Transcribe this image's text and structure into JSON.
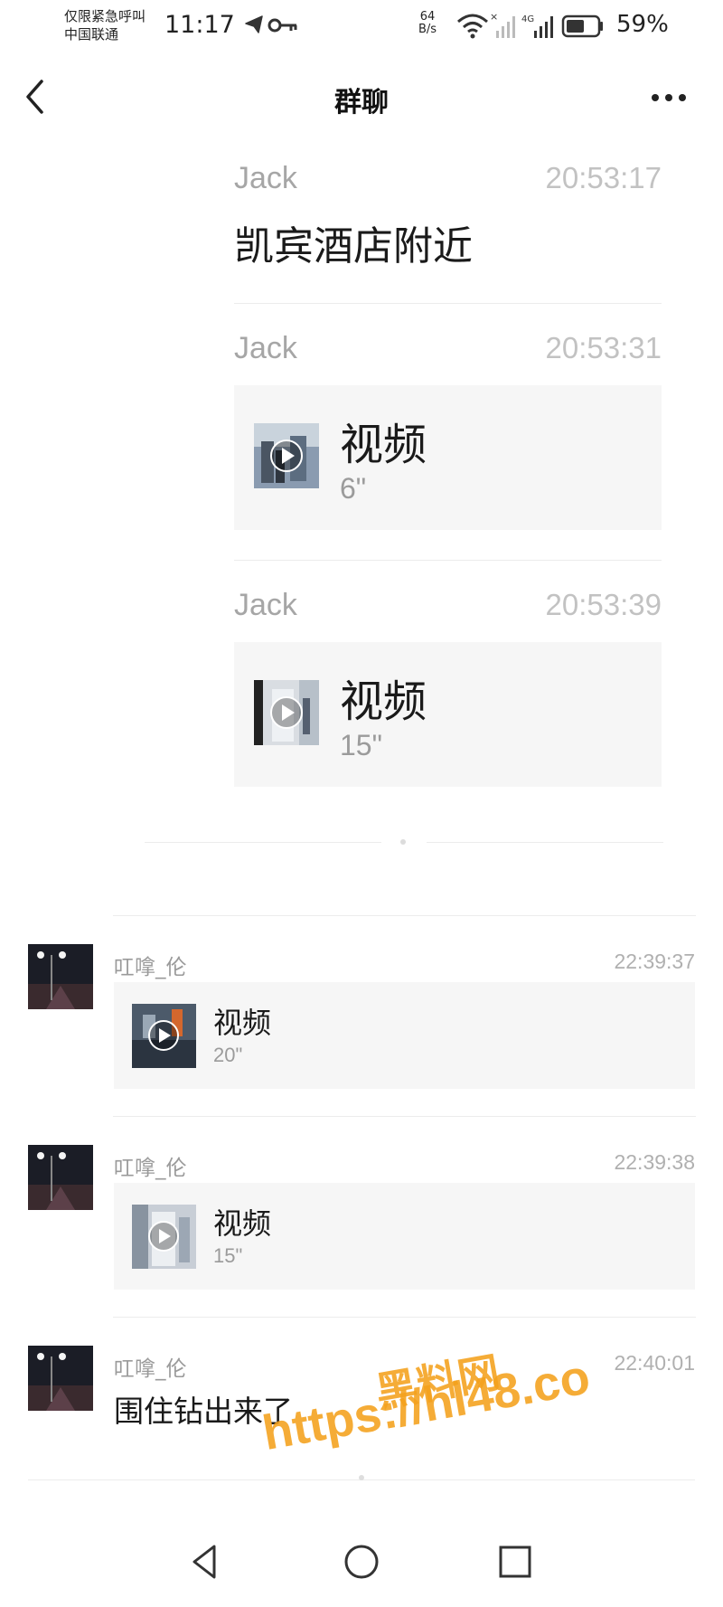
{
  "status_bar": {
    "carrier_line1": "仅限紧急呼叫",
    "carrier_line2": "中国联通",
    "time": "11:17",
    "net_speed_value": "64",
    "net_speed_unit": "B/s",
    "network_type": "4G",
    "battery_percent": "59%",
    "icons": [
      "telegram-icon",
      "key-icon",
      "wifi-icon",
      "signal-icon",
      "battery-icon"
    ]
  },
  "header": {
    "title": "群聊",
    "icons": [
      "back-chevron-icon",
      "more-dots-icon"
    ]
  },
  "quoted": [
    {
      "sender": "Jack",
      "time": "20:53:17",
      "type": "text",
      "text": "凯宾酒店附近"
    },
    {
      "sender": "Jack",
      "time": "20:53:31",
      "type": "video",
      "label": "视频",
      "duration": "6\""
    },
    {
      "sender": "Jack",
      "time": "20:53:39",
      "type": "video",
      "label": "视频",
      "duration": "15\""
    }
  ],
  "messages": [
    {
      "sender": "叿嗱_伦",
      "time": "22:39:37",
      "type": "video",
      "label": "视频",
      "duration": "20\""
    },
    {
      "sender": "叿嗱_伦",
      "time": "22:39:38",
      "type": "video",
      "label": "视频",
      "duration": "15\""
    },
    {
      "sender": "叿嗱_伦",
      "time": "22:40:01",
      "type": "text",
      "text": "围住钻出来了"
    }
  ],
  "watermark": {
    "cn": "黑料网",
    "url": "https://hl48.co"
  },
  "nav_bar": {
    "icons": [
      "back-triangle-icon",
      "home-circle-icon",
      "recents-square-icon"
    ]
  },
  "colors": {
    "accent_watermark": "#f4a11c",
    "card_bg": "#f6f6f6",
    "divider": "#ececec"
  }
}
